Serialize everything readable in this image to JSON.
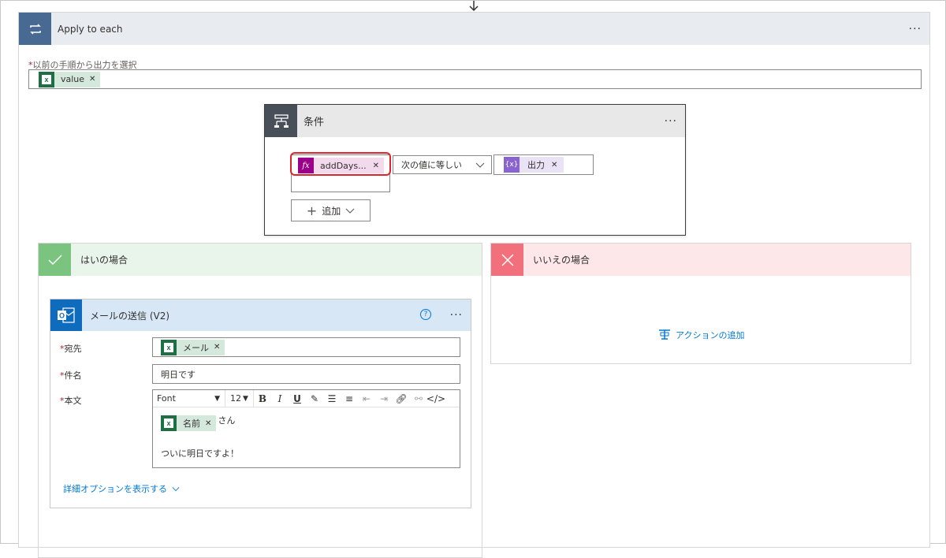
{
  "loop": {
    "title": "Apply to each",
    "more": "···"
  },
  "select_output": {
    "required_mark": "*",
    "label": "以前の手順から出力を選択",
    "token": "value"
  },
  "condition": {
    "title": "条件",
    "more": "···",
    "left_token": "addDays...",
    "operator": "次の値に等しい",
    "right_token": "出力",
    "add_label": "追加"
  },
  "yes_branch": {
    "title": "はいの場合"
  },
  "no_branch": {
    "title": "いいえの場合",
    "add_action": "アクションの追加"
  },
  "mail": {
    "title": "メールの送信 (V2)",
    "help": "?",
    "more": "···",
    "to_label": "宛先",
    "to_token": "メール",
    "subject_label": "件名",
    "subject_value": "明日です",
    "body_label": "本文",
    "font": "Font",
    "size": "12",
    "body_token": "名前",
    "body_suffix": "さん",
    "body_text": "ついに明日ですよ！",
    "advanced": "詳細オプションを表示する"
  },
  "toolbar_icons": [
    "bold-icon",
    "italic-icon",
    "underline-icon",
    "paint-icon",
    "bullet-list-icon",
    "numbered-list-icon",
    "decrease-indent-icon",
    "increase-indent-icon",
    "link-icon",
    "unlink-icon",
    "code-view-icon"
  ],
  "colors": {
    "loop_header": "#486991",
    "condition_header": "#484f58",
    "yes": "#7bc47f",
    "no": "#f1707b",
    "excel": "#1d7044",
    "expression": "#9a0089",
    "variable": "#8a63d2",
    "outlook": "#0f6cbd",
    "highlight": "#e0222a"
  }
}
